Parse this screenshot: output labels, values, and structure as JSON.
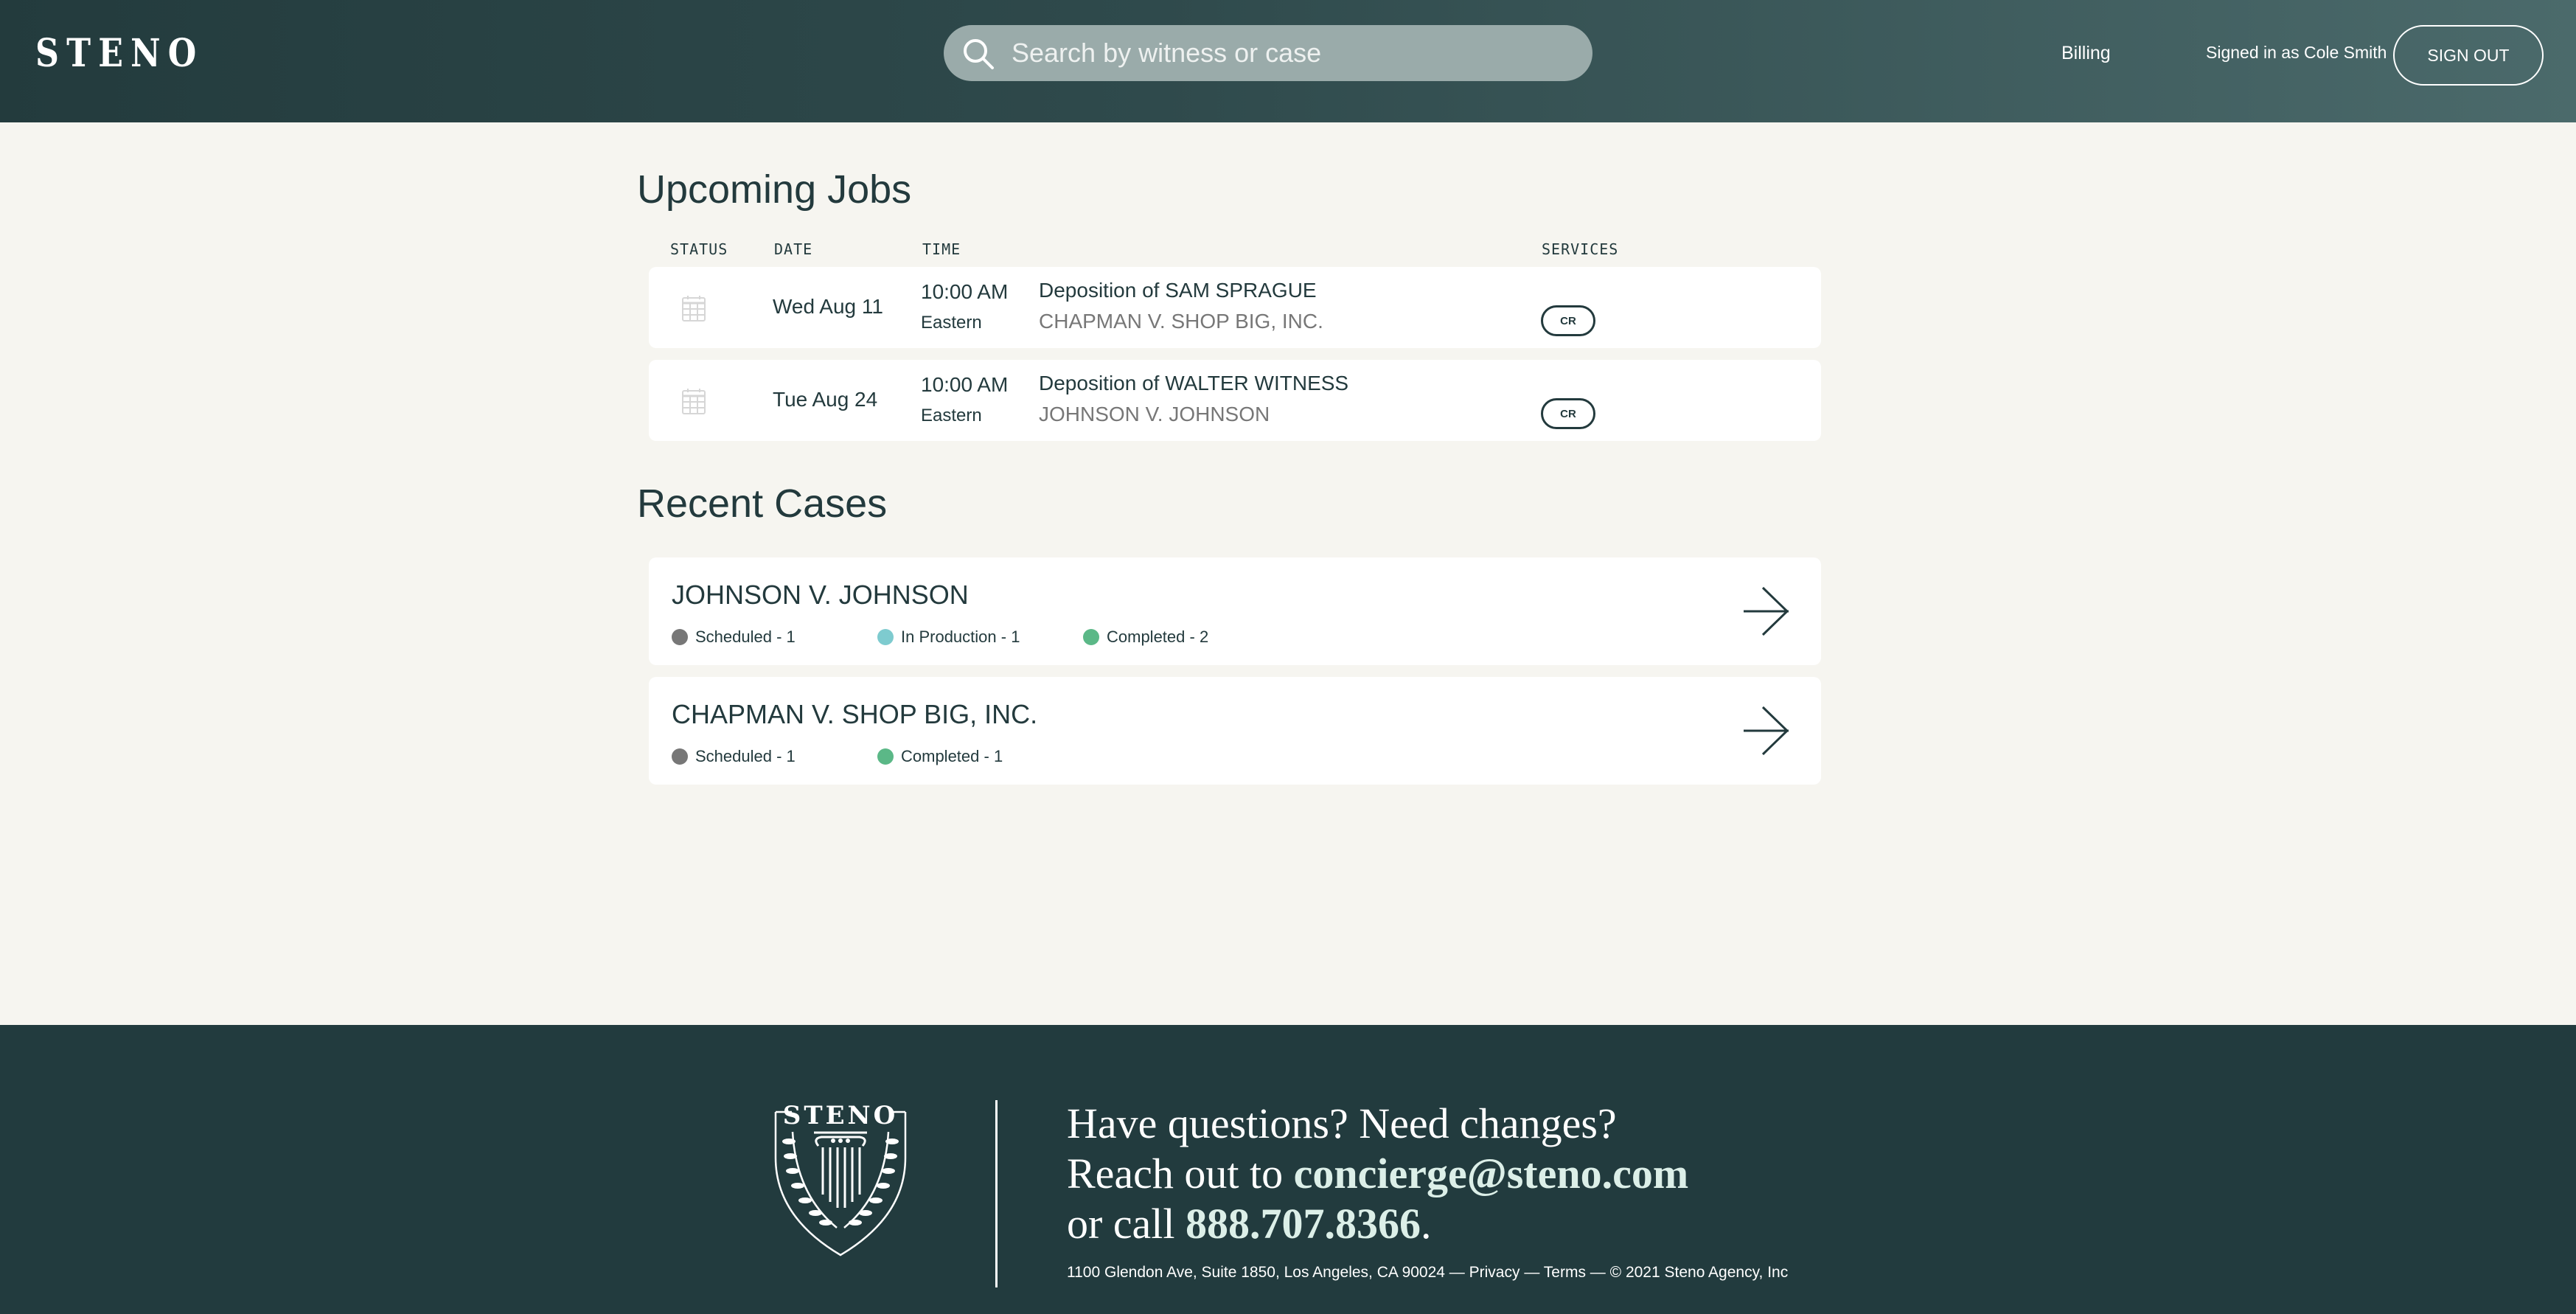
{
  "header": {
    "logo": "STENO",
    "search_placeholder": "Search by witness or case",
    "billing": "Billing",
    "signed_in": "Signed in as Cole Smith",
    "sign_out": "SIGN OUT"
  },
  "upcoming": {
    "title": "Upcoming Jobs",
    "columns": {
      "status": "STATUS",
      "date": "DATE",
      "time": "TIME",
      "services": "SERVICES"
    },
    "jobs": [
      {
        "status_icon": "calendar-icon",
        "date": "Wed Aug 11",
        "time": "10:00 AM",
        "timezone": "Eastern",
        "title": "Deposition of SAM SPRAGUE",
        "case": "CHAPMAN V. SHOP BIG, INC.",
        "service": "CR"
      },
      {
        "status_icon": "calendar-icon",
        "date": "Tue Aug 24",
        "time": "10:00 AM",
        "timezone": "Eastern",
        "title": "Deposition of WALTER WITNESS",
        "case": "JOHNSON V. JOHNSON",
        "service": "CR"
      }
    ]
  },
  "recent": {
    "title": "Recent Cases",
    "cases": [
      {
        "name": "JOHNSON V. JOHNSON",
        "stats": [
          {
            "label": "Scheduled - 1",
            "color": "#777777"
          },
          {
            "label": "In Production - 1",
            "color": "#7ecbcf"
          },
          {
            "label": "Completed - 2",
            "color": "#5bb887"
          }
        ]
      },
      {
        "name": "CHAPMAN V. SHOP BIG, INC.",
        "stats": [
          {
            "label": "Scheduled - 1",
            "color": "#777777"
          },
          {
            "label": "Completed - 1",
            "color": "#5bb887"
          }
        ]
      }
    ]
  },
  "footer": {
    "crest_text": "STENO",
    "line1": "Have questions? Need changes?",
    "line2_prefix": "Reach out to ",
    "email": "concierge@steno.com",
    "line3_prefix": "or call ",
    "phone": "888.707.8366",
    "line3_suffix": ".",
    "address": "1100 Glendon Ave, Suite 1850, Los Angeles, CA 90024",
    "sep": " — ",
    "privacy": "Privacy",
    "terms": "Terms",
    "copyright": "© 2021 Steno Agency, Inc"
  },
  "colors": {
    "brand_dark": "#223b3e",
    "background": "#f6f5f0",
    "scheduled": "#777777",
    "in_production": "#7ecbcf",
    "completed": "#5bb887"
  }
}
